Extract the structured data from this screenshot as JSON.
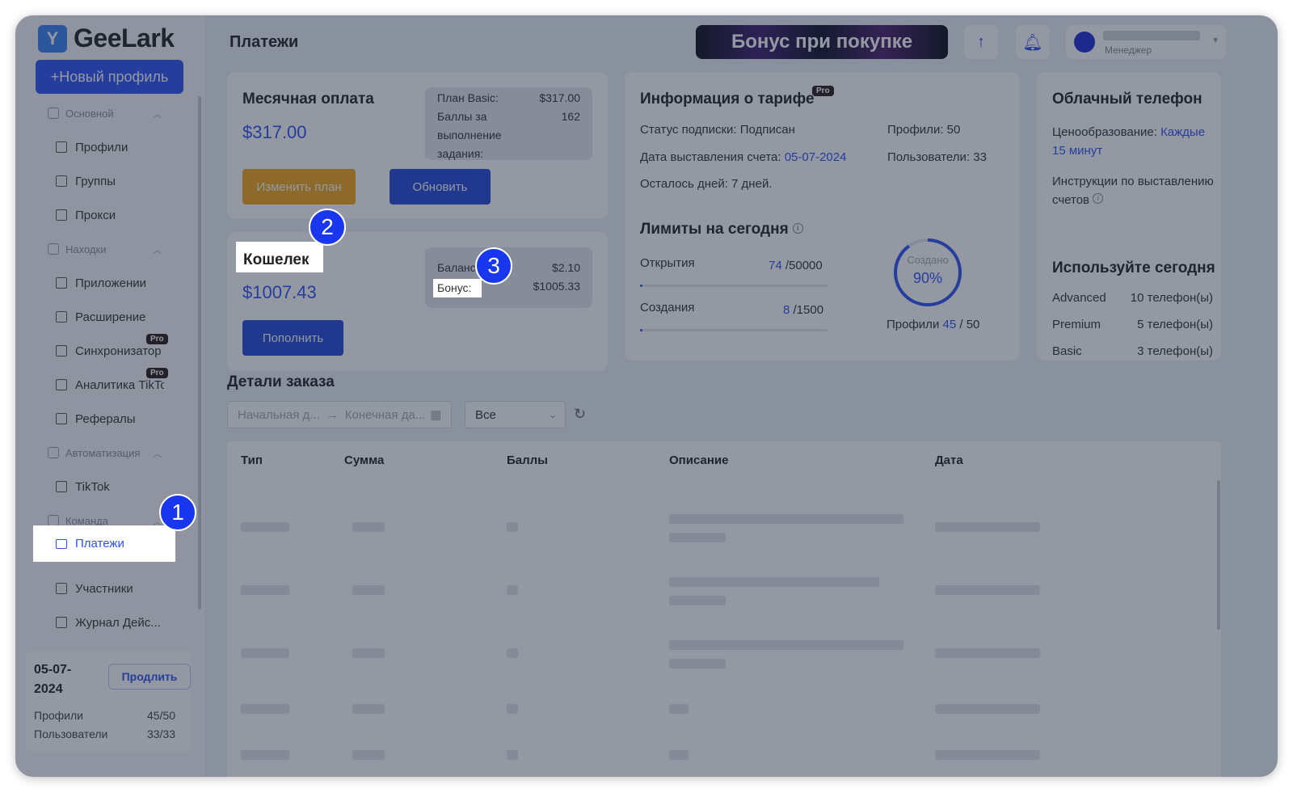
{
  "app": {
    "logo_text": "GeeLark",
    "logo_glyph": "Y",
    "new_profile_label": "+Новый профиль",
    "brand_color": "#2d52f5"
  },
  "sidebar": {
    "groups": [
      {
        "label": "Основной",
        "items": [
          "Профили",
          "Группы",
          "Прокси"
        ]
      },
      {
        "label": "Находки",
        "items": [
          "Приложении",
          "Расширение",
          "Синхронизатор",
          "Аналитика TikTok",
          "Рефералы"
        ]
      },
      {
        "label": "Автоматизация",
        "items": [
          "TikTok"
        ]
      },
      {
        "label": "Команда",
        "items": [
          "Платежи",
          "Участники",
          "Журнал Дейс..."
        ]
      }
    ],
    "pro_badge": "Pro",
    "active_item": "Платежи",
    "subscription": {
      "date": "05-07-2024",
      "extend_label": "Продлить",
      "profiles_label": "Профили",
      "profiles_value": "45/50",
      "users_label": "Пользователи",
      "users_value": "33/33"
    }
  },
  "header": {
    "title": "Платежи",
    "banner_text": "Бонус при покупке",
    "user_role": "Менеджер"
  },
  "monthly": {
    "title": "Месячная оплата",
    "amount": "$317.00",
    "plan_label": "План Basic:",
    "plan_value": "$317.00",
    "points_label": "Баллы за выполнение задания:",
    "points_value": "162",
    "change_plan_label": "Изменить план",
    "update_label": "Обновить"
  },
  "wallet": {
    "title": "Кошелек",
    "amount": "$1007.43",
    "balance_label": "Баланс",
    "balance_value": "$2.10",
    "bonus_label": "Бонус:",
    "bonus_value": "$1005.33",
    "topup_label": "Пополнить"
  },
  "tariff": {
    "title": "Информация о тарифе",
    "status": "Статус подписки: Подписан",
    "invoice_label": "Дата выставления счета: ",
    "invoice_date": "05-07-2024",
    "days_left": "Осталось дней: 7 дней.",
    "profiles": "Профили: 50",
    "users": "Пользователи: 33",
    "limits_title": "Лимиты на сегодня",
    "opens_label": "Открытия",
    "opens_value": "74",
    "opens_max": "/50000",
    "opens_fraction": 0.0015,
    "creates_label": "Создания",
    "creates_value": "8",
    "creates_max": "/1500",
    "creates_fraction": 0.005,
    "ring_label": "Создано",
    "ring_percent": "90%",
    "ring_fraction": 0.9,
    "ring_profiles_label": "Профили",
    "ring_profiles_value": "45",
    "ring_profiles_max": "/ 50"
  },
  "cloud": {
    "title": "Облачный телефон",
    "pricing_label": "Ценообразование: ",
    "pricing_value": "Каждые 15 минут",
    "instructions": "Инструкции по выставлению счетов",
    "use_today_title": "Используйте сегодня",
    "rows": [
      {
        "name": "Advanced",
        "value": "10 телефон(ы)"
      },
      {
        "name": "Premium",
        "value": "5 телефон(ы)"
      },
      {
        "name": "Basic",
        "value": "3 телефон(ы)"
      }
    ]
  },
  "orders": {
    "title": "Детали заказа",
    "start_placeholder": "Начальная д...",
    "end_placeholder": "Конечная да...",
    "filter_value": "Все",
    "columns": [
      "Тип",
      "Сумма",
      "Баллы",
      "Описание",
      "Дата"
    ]
  },
  "markers": [
    "1",
    "2",
    "3"
  ]
}
